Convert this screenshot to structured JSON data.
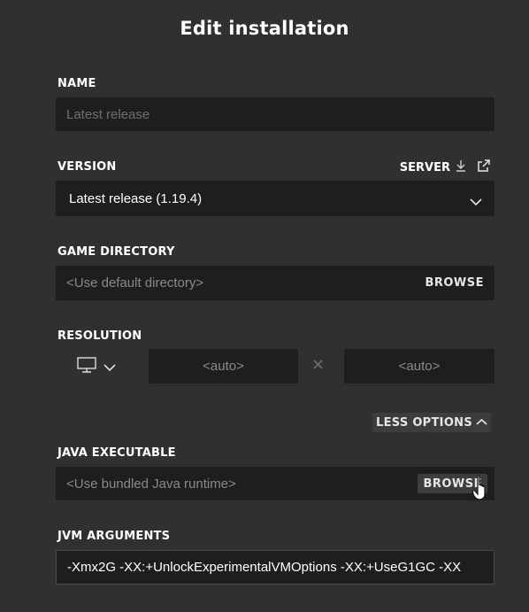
{
  "dialog": {
    "title": "Edit installation"
  },
  "name": {
    "label": "NAME",
    "placeholder": "Latest release"
  },
  "version": {
    "label": "VERSION",
    "server_label": "SERVER",
    "selected": "Latest release (1.19.4)",
    "icons": [
      "download-icon",
      "external-link-icon",
      "chevron-down-icon"
    ]
  },
  "game_directory": {
    "label": "GAME DIRECTORY",
    "placeholder": "<Use default directory>",
    "browse_label": "BROWSE"
  },
  "resolution": {
    "label": "RESOLUTION",
    "width_placeholder": "<auto>",
    "height_placeholder": "<auto>",
    "icons": [
      "monitor-icon",
      "chevron-down-icon",
      "times-icon"
    ]
  },
  "options_toggle": {
    "label": "LESS OPTIONS",
    "icon": "chevron-up-icon"
  },
  "java_executable": {
    "label": "JAVA EXECUTABLE",
    "placeholder": "<Use bundled Java runtime>",
    "browse_label": "BROWSE"
  },
  "jvm_arguments": {
    "label": "JVM ARGUMENTS",
    "value": "-Xmx2G -XX:+UnlockExperimentalVMOptions -XX:+UseG1GC -XX"
  },
  "colors": {
    "background": "#303030",
    "field": "#1e1e1e",
    "text": "#ffffff",
    "placeholder": "#8a8a8a"
  }
}
